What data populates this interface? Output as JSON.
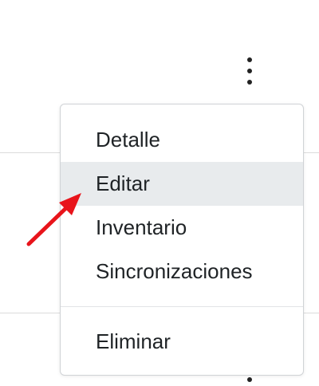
{
  "menu": {
    "items": [
      {
        "label": "Detalle"
      },
      {
        "label": "Editar"
      },
      {
        "label": "Inventario"
      },
      {
        "label": "Sincronizaciones"
      }
    ],
    "danger_item": {
      "label": "Eliminar"
    }
  },
  "icons": {
    "kebab": "more-vertical-icon",
    "pointer": "red-arrow-icon"
  },
  "colors": {
    "highlight": "#e8ebed",
    "arrow": "#e8141b",
    "text": "#1f2326"
  }
}
